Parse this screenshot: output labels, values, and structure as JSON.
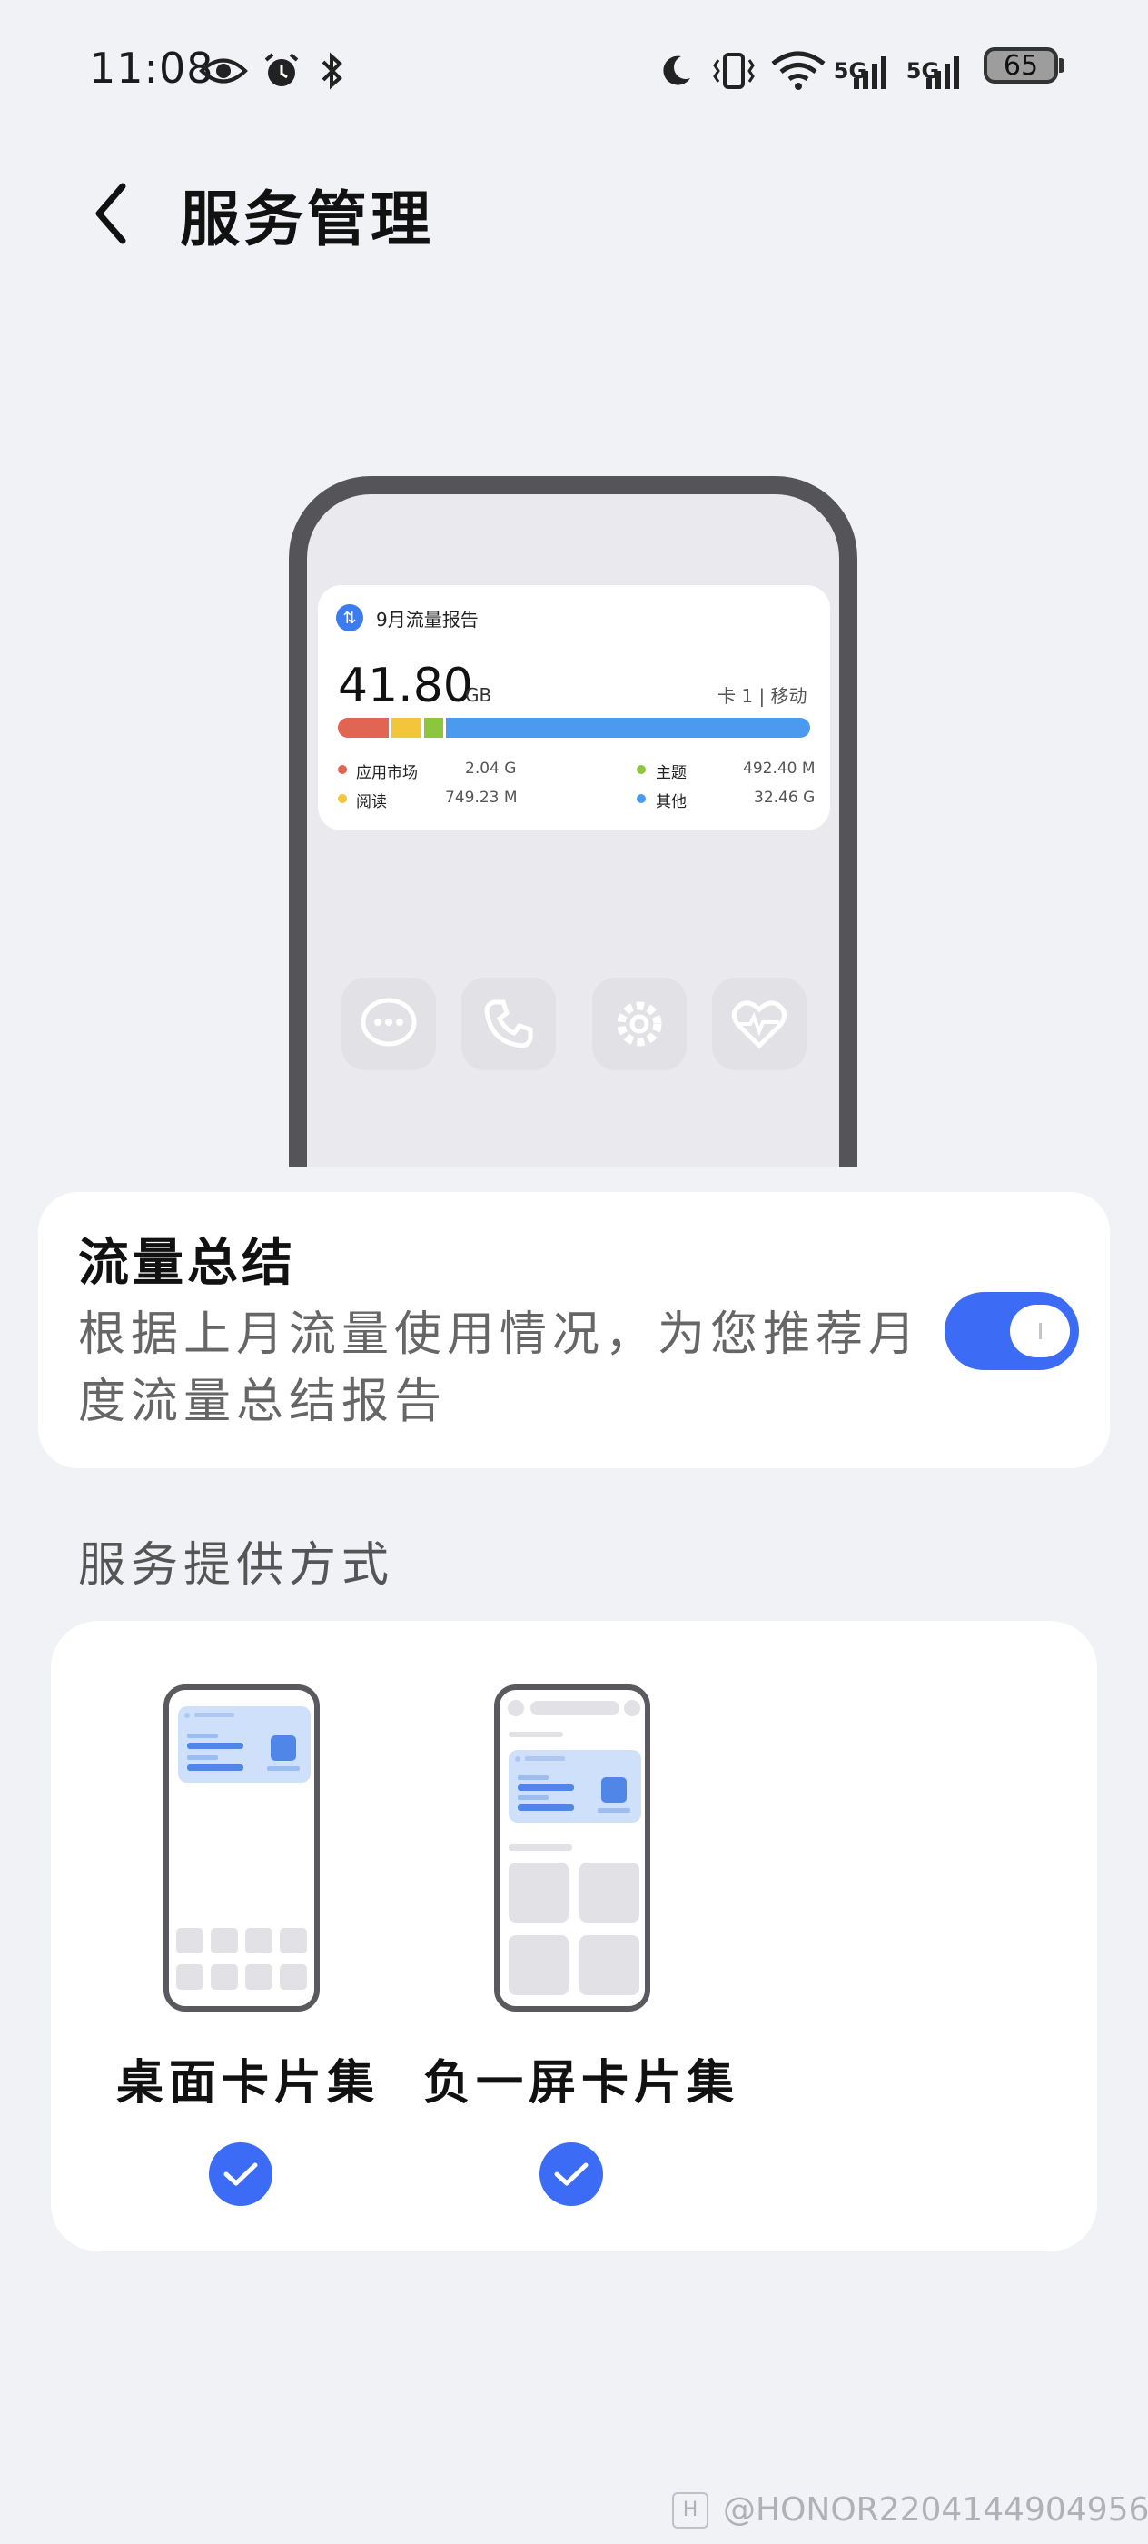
{
  "status_bar": {
    "time": "11:08",
    "net1": "5G",
    "net2": "5G",
    "battery": "65"
  },
  "header": {
    "title": "服务管理"
  },
  "preview_widget": {
    "title": "9月流量报告",
    "total": "41.80",
    "unit": "GB",
    "sim": "卡 1 | 移动",
    "usage_bar_colors": [
      "#e26452",
      "#f3c53a",
      "#8cc63f",
      "#4a9af0"
    ],
    "usage_bar_fractions": [
      0.11,
      0.065,
      0.04,
      0.785
    ],
    "legend": [
      {
        "label": "应用市场",
        "value": "2.04 G",
        "color": "#e26452"
      },
      {
        "label": "阅读",
        "value": "749.23 M",
        "color": "#f3c53a"
      },
      {
        "label": "主题",
        "value": "492.40 M",
        "color": "#8cc63f"
      },
      {
        "label": "其他",
        "value": "32.46 G",
        "color": "#4a9af0"
      }
    ],
    "dock_icons": [
      "message-icon",
      "phone-icon",
      "settings-icon",
      "health-icon"
    ]
  },
  "summary_card": {
    "title": "流量总结",
    "description": "根据上月流量使用情况，为您推荐月度流量总结报告",
    "toggle_on": true
  },
  "provision": {
    "section_title": "服务提供方式",
    "options": [
      {
        "label": "桌面卡片集",
        "checked": true
      },
      {
        "label": "负一屏卡片集",
        "checked": true
      }
    ]
  },
  "watermark": "@HONOR2204144904956",
  "colors": {
    "accent": "#3c6cf5",
    "background": "#f1f2f6"
  }
}
